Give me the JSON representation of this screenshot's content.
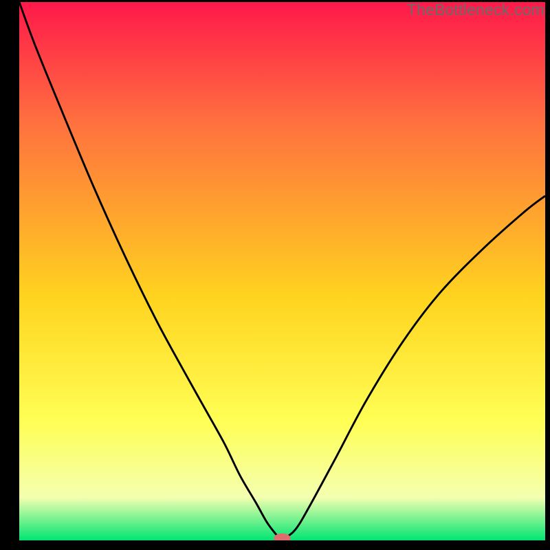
{
  "watermark": "TheBottleneck.com",
  "colors": {
    "gradient_top": "#ff184a",
    "gradient_mid_upper": "#ff6f3f",
    "gradient_mid": "#ffd41f",
    "gradient_mid_lower": "#ffff55",
    "gradient_lower": "#f4ffb0",
    "gradient_bottom": "#00e572",
    "curve": "#000000",
    "marker": "#de6d6d",
    "frame": "#000000"
  },
  "chart_data": {
    "type": "line",
    "title": "",
    "xlabel": "",
    "ylabel": "",
    "xlim": [
      0,
      100
    ],
    "ylim": [
      0,
      100
    ],
    "x": [
      0,
      3,
      8,
      14,
      20,
      26,
      31,
      35,
      39,
      42,
      45,
      47,
      48.5,
      49.5,
      50.5,
      52.5,
      55,
      60,
      66,
      73,
      80,
      88,
      96,
      100
    ],
    "values": [
      100,
      92,
      80,
      66,
      53,
      41,
      32,
      25,
      18,
      12,
      7,
      3.5,
      1.5,
      0.5,
      0.5,
      2,
      6,
      15,
      26,
      37,
      46,
      54,
      61,
      64
    ],
    "minimum_marker": {
      "x": 50,
      "y": 0.4
    },
    "annotations": []
  }
}
